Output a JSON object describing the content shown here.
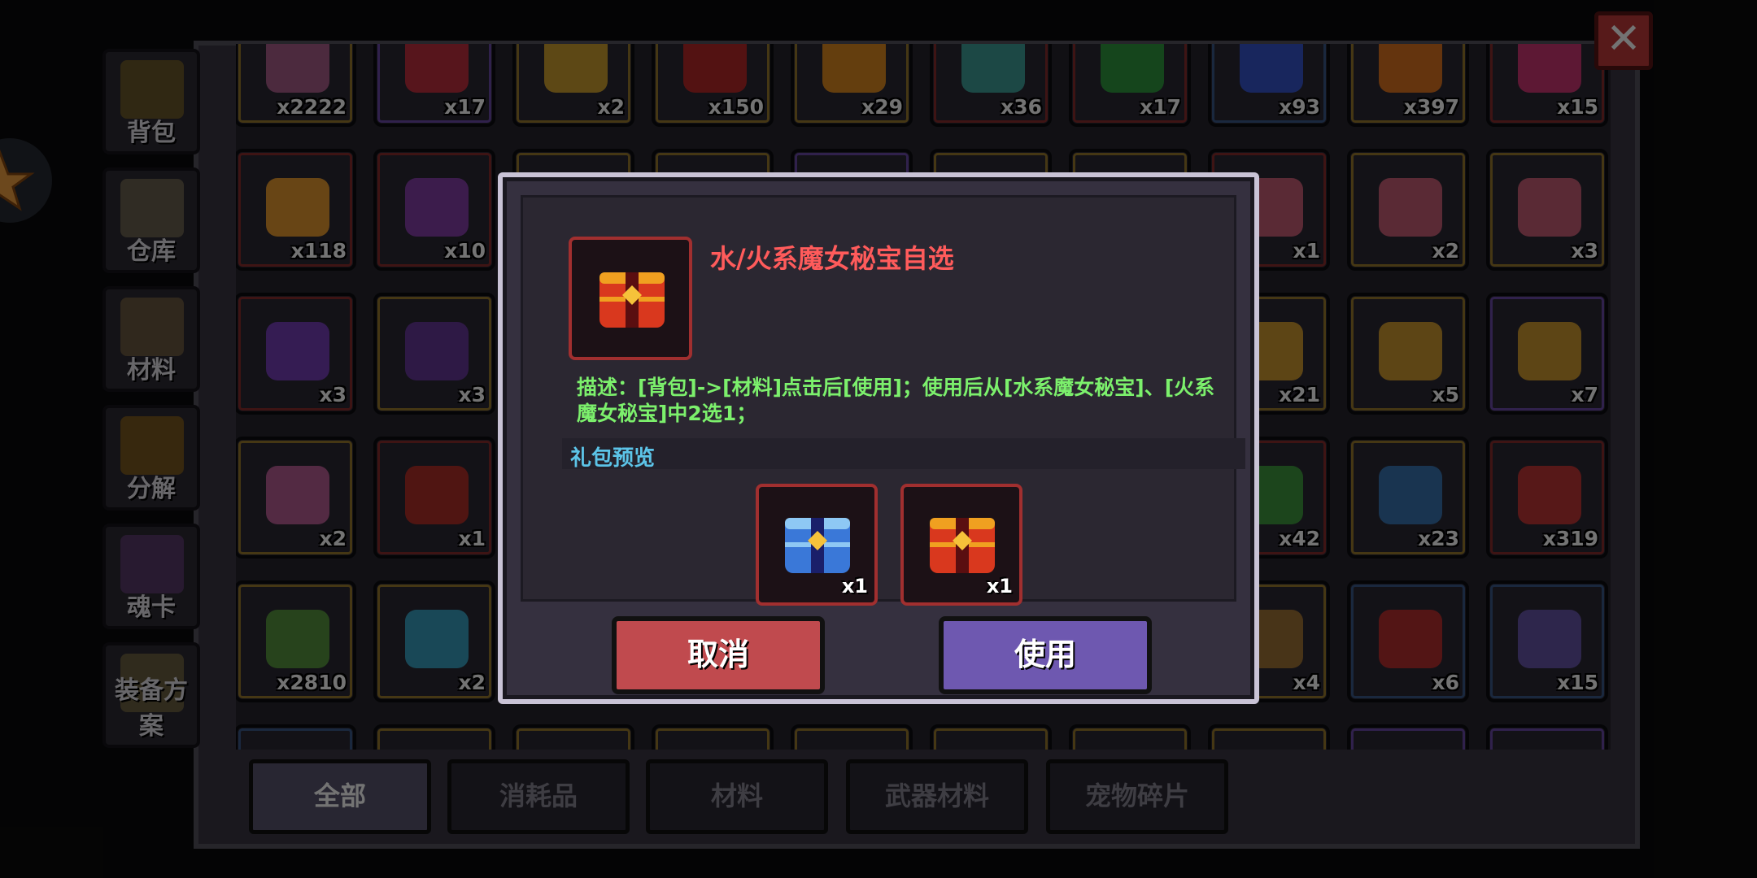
{
  "inventory": {
    "grid": [
      {
        "count": "x2222",
        "color": "#9a7a2e",
        "icon": "pink-item-icon"
      },
      {
        "count": "x17",
        "color": "#6a4aa8",
        "icon": "red-item-icon"
      },
      {
        "count": "x2",
        "color": "#9a7a2e",
        "icon": "gold-item-icon"
      },
      {
        "count": "x150",
        "color": "#9a7a2e",
        "icon": "red-cap-icon"
      },
      {
        "count": "x29",
        "color": "#9a7a2e",
        "icon": "orange-gem-icon"
      },
      {
        "count": "x36",
        "color": "#8a2e2e",
        "icon": "rainbow-gem-icon"
      },
      {
        "count": "x17",
        "color": "#8a2e2e",
        "icon": "green-gem-icon"
      },
      {
        "count": "x93",
        "color": "#3a5a8a",
        "icon": "blue-crystal-icon"
      },
      {
        "count": "x397",
        "color": "#9a7a2e",
        "icon": "orange-crystal-icon"
      },
      {
        "count": "x15",
        "color": "#8a2e2e",
        "icon": "pink-crystal-icon"
      },
      {
        "count": "x118",
        "color": "#8a2e2e",
        "icon": "explosion-icon"
      },
      {
        "count": "x10",
        "color": "#8a2e2e",
        "icon": "purple-bulb-icon"
      },
      {
        "count": "",
        "color": "#9a7a2e",
        "icon": ""
      },
      {
        "count": "",
        "color": "#9a7a2e",
        "icon": ""
      },
      {
        "count": "",
        "color": "#6a4aa8",
        "icon": ""
      },
      {
        "count": "",
        "color": "#9a7a2e",
        "icon": ""
      },
      {
        "count": "",
        "color": "#9a7a2e",
        "icon": ""
      },
      {
        "count": "x1",
        "color": "#8a2e2e",
        "icon": "pink-chest-icon"
      },
      {
        "count": "x2",
        "color": "#9a7a2e",
        "icon": "pink-chest-icon"
      },
      {
        "count": "x3",
        "color": "#9a7a2e",
        "icon": "pink-chest-icon"
      },
      {
        "count": "x3",
        "color": "#8a2e2e",
        "icon": "battery-icon"
      },
      {
        "count": "x3",
        "color": "#9a7a2e",
        "icon": "purple-scroll-icon"
      },
      {
        "count": "",
        "color": "#9a7a2e",
        "icon": ""
      },
      {
        "count": "",
        "color": "#9a7a2e",
        "icon": ""
      },
      {
        "count": "",
        "color": "#6a4aa8",
        "icon": ""
      },
      {
        "count": "",
        "color": "#9a7a2e",
        "icon": ""
      },
      {
        "count": "",
        "color": "#9a7a2e",
        "icon": ""
      },
      {
        "count": "x21",
        "color": "#9a7a2e",
        "icon": "gold-chest-icon"
      },
      {
        "count": "x5",
        "color": "#9a7a2e",
        "icon": "gold-chest-icon"
      },
      {
        "count": "x7",
        "color": "#6a4aa8",
        "icon": "gold-chest-icon"
      },
      {
        "count": "x2",
        "color": "#9a7a2e",
        "icon": "pink-scroll-icon"
      },
      {
        "count": "x1",
        "color": "#8a2e2e",
        "icon": "red-chest-icon"
      },
      {
        "count": "",
        "color": "#9a7a2e",
        "icon": ""
      },
      {
        "count": "",
        "color": "#9a7a2e",
        "icon": ""
      },
      {
        "count": "",
        "color": "#6a4aa8",
        "icon": ""
      },
      {
        "count": "",
        "color": "#9a7a2e",
        "icon": ""
      },
      {
        "count": "",
        "color": "#9a7a2e",
        "icon": ""
      },
      {
        "count": "x42",
        "color": "#8a2e2e",
        "icon": "green-leaf-icon"
      },
      {
        "count": "x23",
        "color": "#9a7a2e",
        "icon": "star-jar-icon"
      },
      {
        "count": "x319",
        "color": "#8a2e2e",
        "icon": "shield-icon"
      },
      {
        "count": "x2810",
        "color": "#9a7a2e",
        "icon": "green-coin-icon"
      },
      {
        "count": "x2",
        "color": "#9a7a2e",
        "icon": "blue-spiral-icon"
      },
      {
        "count": "",
        "color": "#9a7a2e",
        "icon": ""
      },
      {
        "count": "",
        "color": "#9a7a2e",
        "icon": ""
      },
      {
        "count": "",
        "color": "#6a4aa8",
        "icon": ""
      },
      {
        "count": "",
        "color": "#9a7a2e",
        "icon": ""
      },
      {
        "count": "",
        "color": "#9a7a2e",
        "icon": ""
      },
      {
        "count": "x4",
        "color": "#9a7a2e",
        "icon": "brown-scroll-icon"
      },
      {
        "count": "x6",
        "color": "#3a5a8a",
        "icon": "red-feather-icon"
      },
      {
        "count": "x15",
        "color": "#3a5a8a",
        "icon": "purple-feather-icon"
      },
      {
        "count": "",
        "color": "#3a5a8a",
        "icon": ""
      },
      {
        "count": "",
        "color": "#9a7a2e",
        "icon": ""
      },
      {
        "count": "",
        "color": "#9a7a2e",
        "icon": ""
      },
      {
        "count": "",
        "color": "#9a7a2e",
        "icon": ""
      },
      {
        "count": "",
        "color": "#9a7a2e",
        "icon": ""
      },
      {
        "count": "",
        "color": "#9a7a2e",
        "icon": ""
      },
      {
        "count": "",
        "color": "#9a7a2e",
        "icon": ""
      },
      {
        "count": "",
        "color": "#9a7a2e",
        "icon": ""
      },
      {
        "count": "",
        "color": "#6a4aa8",
        "icon": ""
      },
      {
        "count": "",
        "color": "#6a4aa8",
        "icon": ""
      }
    ]
  },
  "sidebar": {
    "items": [
      {
        "label": "背包",
        "icon": "chest-icon"
      },
      {
        "label": "仓库",
        "icon": "warehouse-icon"
      },
      {
        "label": "材料",
        "icon": "material-icon"
      },
      {
        "label": "分解",
        "icon": "decompose-icon"
      },
      {
        "label": "魂卡",
        "icon": "soul-card-icon"
      },
      {
        "label": "装备方案",
        "icon": "equipment-icon"
      }
    ]
  },
  "filter_tabs": [
    {
      "label": "全部"
    },
    {
      "label": "消耗品"
    },
    {
      "label": "材料"
    },
    {
      "label": "武器材料"
    },
    {
      "label": "宠物碎片"
    }
  ],
  "dialog": {
    "title": "水/火系魔女秘宝自选",
    "description": "描述：[背包]->[材料]点击后[使用]；使用后从[水系魔女秘宝]、[火系魔女秘宝]中2选1；",
    "preview_label": "礼包预览",
    "rewards": [
      {
        "count": "x1",
        "icon": "water-witch-chest-icon"
      },
      {
        "count": "x1",
        "icon": "fire-witch-chest-icon"
      }
    ],
    "cancel_label": "取消",
    "use_label": "使用"
  },
  "colors": {
    "title_red": "#ff5b5b",
    "desc_green": "#7cf06c",
    "preview_blue": "#5cc4e8",
    "cancel_red": "#c04a4e",
    "use_purple": "#6e58b0"
  }
}
